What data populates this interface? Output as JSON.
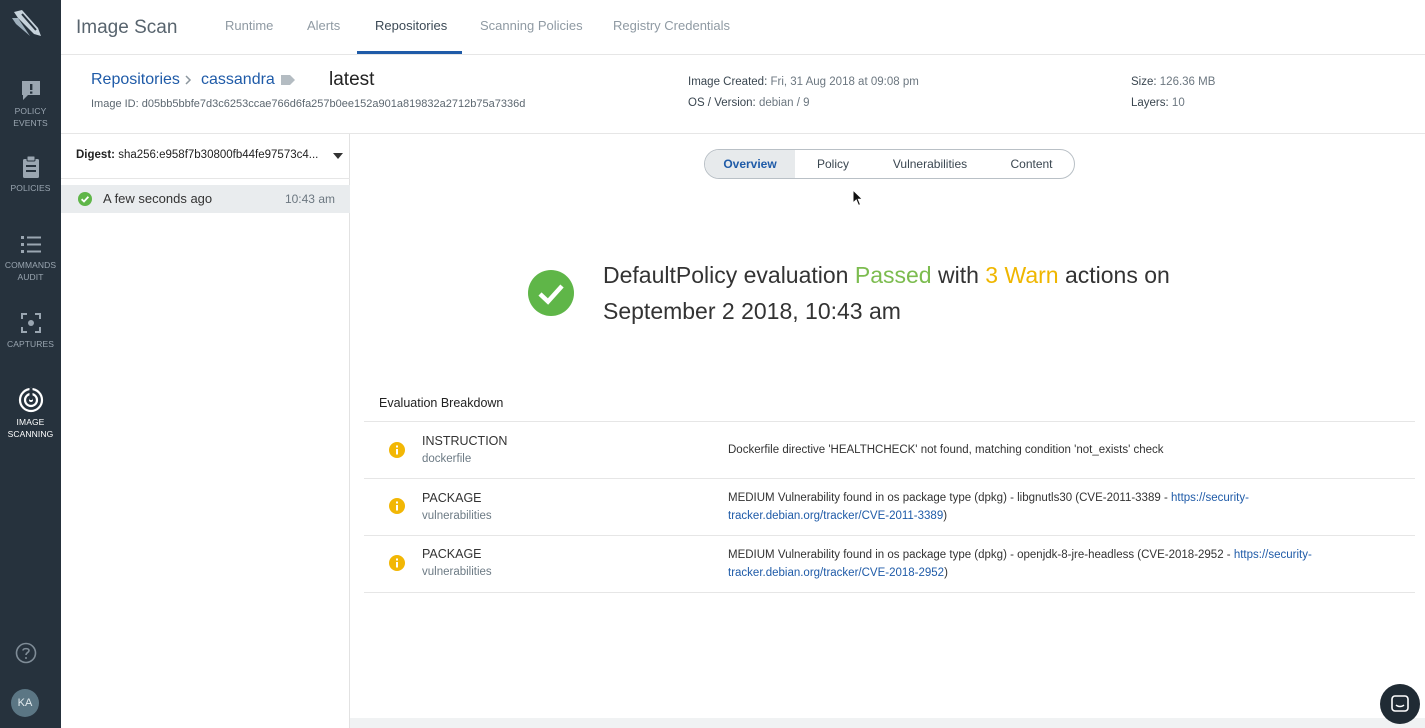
{
  "app": {
    "title": "Image Scan"
  },
  "nav_tabs": [
    {
      "label": "Runtime"
    },
    {
      "label": "Alerts"
    },
    {
      "label": "Repositories"
    },
    {
      "label": "Scanning Policies"
    },
    {
      "label": "Registry Credentials"
    }
  ],
  "active_tab": "Repositories",
  "rail": {
    "items": [
      {
        "line1": "POLICY",
        "line2": "EVENTS"
      },
      {
        "line1": "POLICIES",
        "line2": ""
      },
      {
        "line1": "COMMANDS",
        "line2": "AUDIT"
      },
      {
        "line1": "CAPTURES",
        "line2": ""
      },
      {
        "line1": "IMAGE",
        "line2": "SCANNING"
      }
    ],
    "avatar_initials": "KA"
  },
  "breadcrumb": {
    "root": "Repositories",
    "repo": "cassandra",
    "tag": "latest"
  },
  "image": {
    "id_label": "Image ID:",
    "id": "d05bb5bbfe7d3c6253ccae766d6fa257b0ee152a901a819832a2712b75a7336d",
    "created_label": "Image Created:",
    "created": "Fri, 31 Aug 2018 at 09:08 pm",
    "os_label": "OS / Version:",
    "os": "debian / 9",
    "size_label": "Size:",
    "size": "126.36 MB",
    "layers_label": "Layers:",
    "layers": "10"
  },
  "history": {
    "digest_label": "Digest:",
    "digest": "sha256:e958f7b30800fb44fe97573c4...",
    "rows": [
      {
        "when": "A few seconds ago",
        "time": "10:43 am"
      }
    ]
  },
  "subtabs": [
    {
      "label": "Overview"
    },
    {
      "label": "Policy"
    },
    {
      "label": "Vulnerabilities"
    },
    {
      "label": "Content"
    }
  ],
  "active_subtab": "Overview",
  "summary": {
    "prefix": "DefaultPolicy evaluation",
    "result": "Passed",
    "mid": "with",
    "warn": "3 Warn",
    "suffix": "actions on",
    "date": "September 2 2018, 10:43 am"
  },
  "breakdown": {
    "title": "Evaluation Breakdown",
    "rows": [
      {
        "gate": "INSTRUCTION",
        "trigger": "dockerfile",
        "message": "Dockerfile directive 'HEALTHCHECK' not found, matching condition 'not_exists' check",
        "link": "",
        "tail": ""
      },
      {
        "gate": "PACKAGE",
        "trigger": "vulnerabilities",
        "message": "MEDIUM Vulnerability found in os package type (dpkg) - libgnutls30 (CVE-2011-3389 - ",
        "link": "https://security-tracker.debian.org/tracker/CVE-2011-3389",
        "tail": ")"
      },
      {
        "gate": "PACKAGE",
        "trigger": "vulnerabilities",
        "message": "MEDIUM Vulnerability found in os package type (dpkg) - openjdk-8-jre-headless (CVE-2018-2952 - ",
        "link": "https://security-tracker.debian.org/tracker/CVE-2018-2952",
        "tail": ")"
      }
    ]
  },
  "colors": {
    "rail_bg": "#26323d",
    "accent_blue": "#1f5ba8",
    "pass_green": "#7cbc4f",
    "warn_yellow": "#efb600"
  }
}
